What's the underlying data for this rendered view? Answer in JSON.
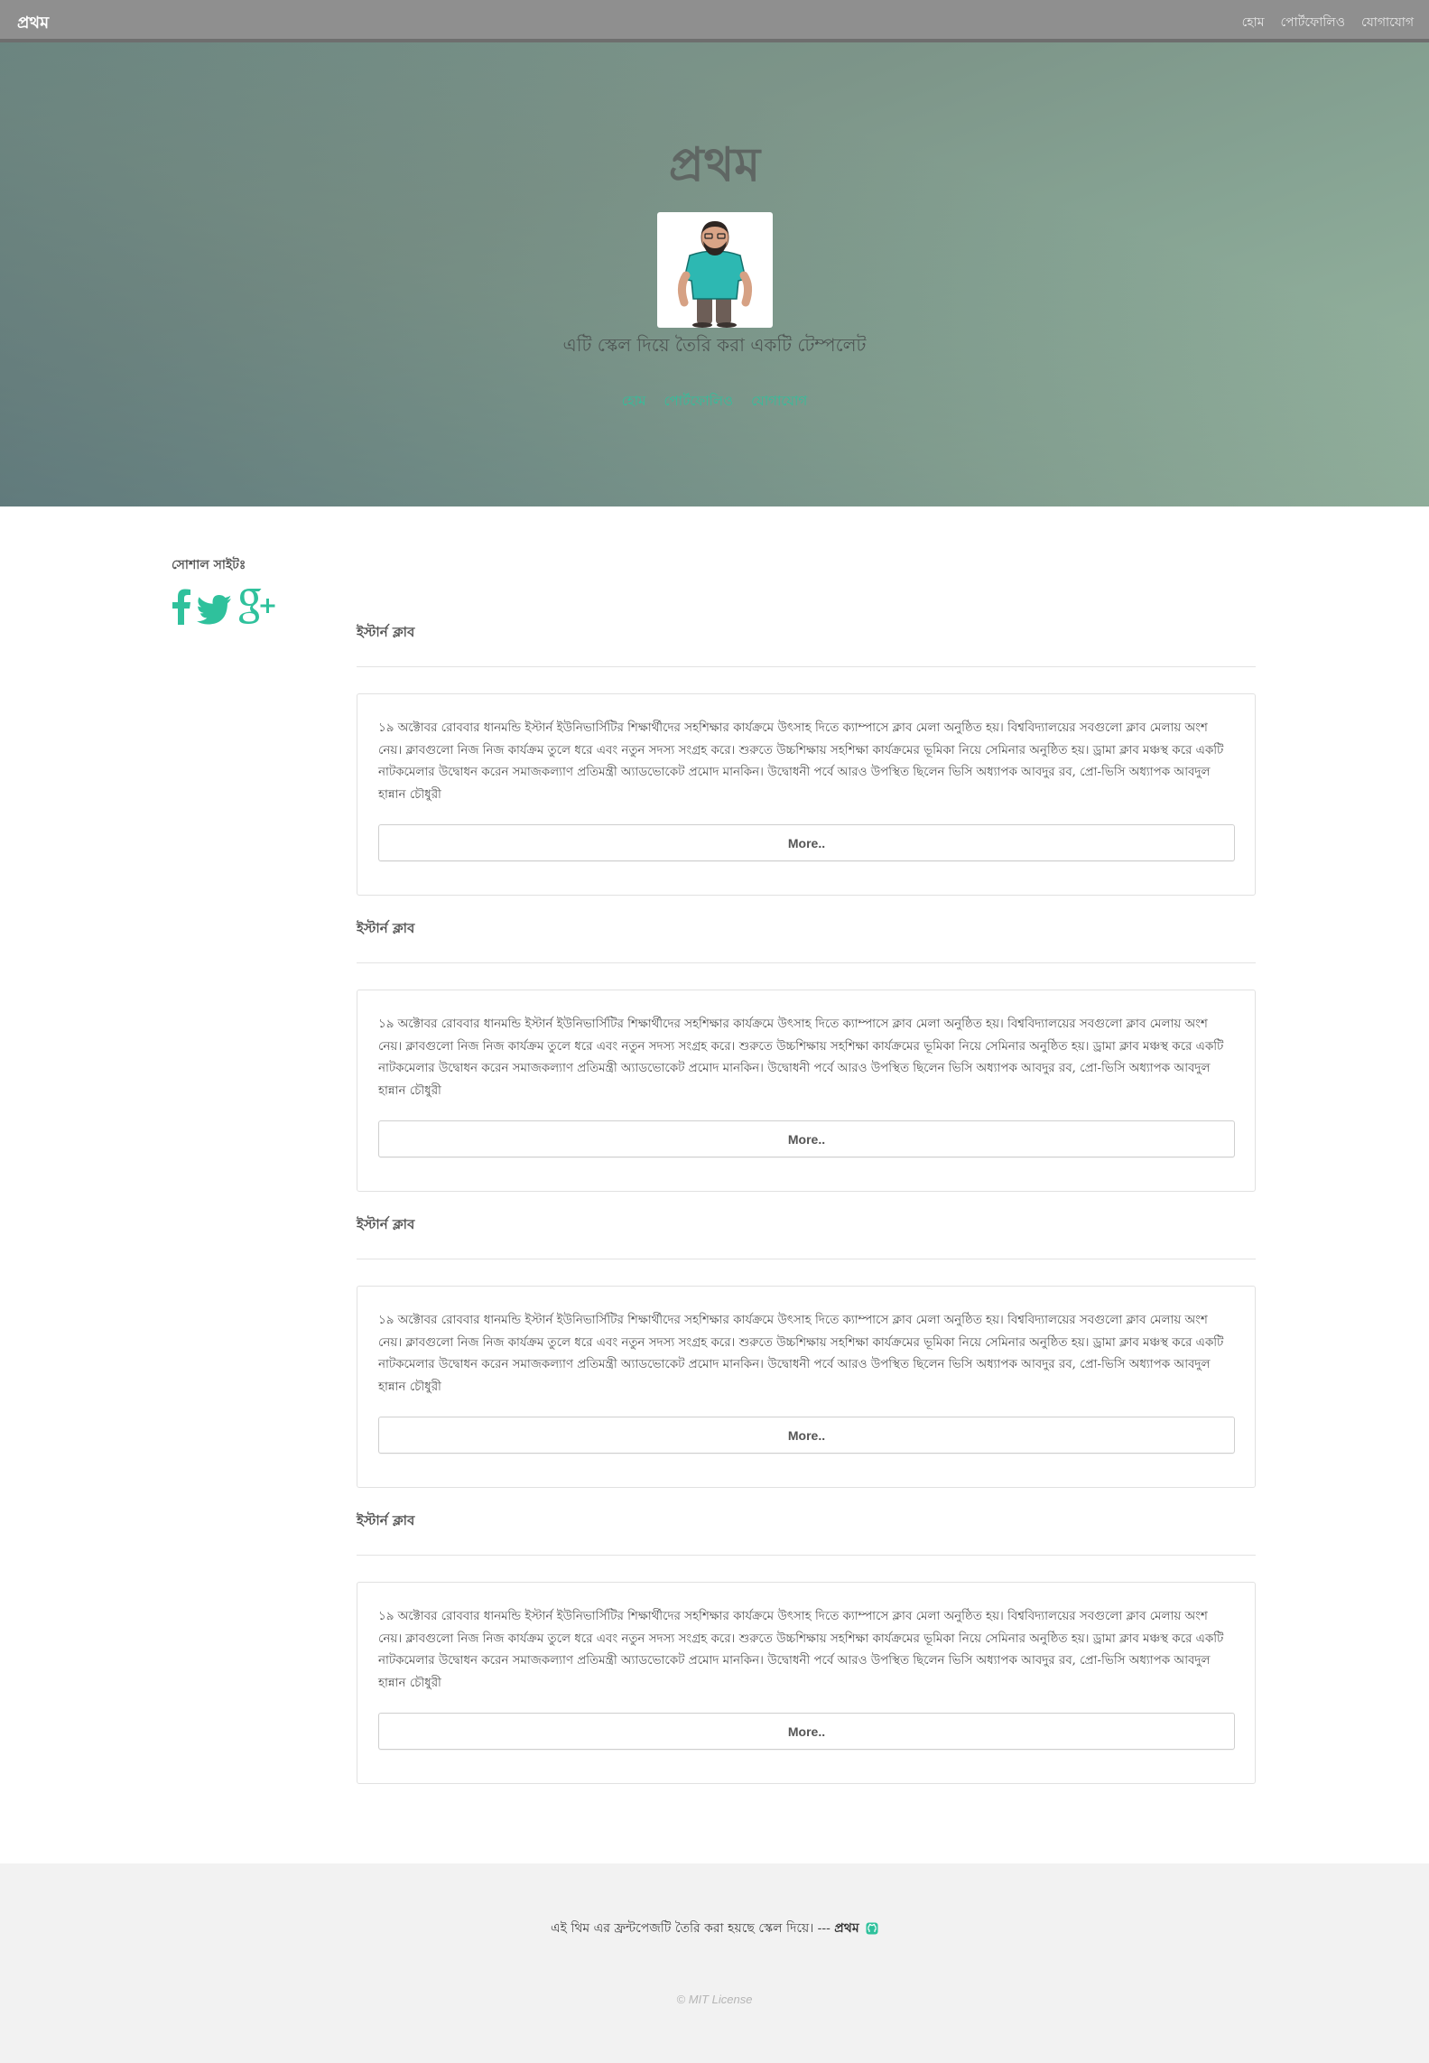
{
  "nav": {
    "brand": "প্রথম",
    "links": [
      "হোম",
      "পোর্টফোলিও",
      "যোগাযোগ"
    ]
  },
  "hero": {
    "title": "প্রথম",
    "subtitle": "এটি স্কেল দিয়ে তৈরি করা একটি টেম্পলেট",
    "links": [
      "হোম",
      "পোর্টফোলিও",
      "যোগাযোগ"
    ]
  },
  "sidebar": {
    "label": "সোশাল সাইটঃ",
    "icons": [
      "facebook-icon",
      "twitter-icon",
      "google-plus-icon"
    ]
  },
  "posts": [
    {
      "title": "ইস্টার্ন ক্লাব",
      "lines": [
        "১৯ অক্টোবর রোববার ধানমন্ডি ইস্টার্ন ইউনিভার্সিটির শিক্ষার্থীদের সহশিক্ষার কার্যক্রমে উৎসাহ দিতে ক্যাম্পাসে ক্লাব মেলা অনুষ্ঠিত হয়। বিশ্ববিদ্যালয়ের সবগুলো ক্লাব মেলায় অংশ",
        "নেয়। ক্লাবগুলো নিজ নিজ কার্যক্রম তুলে ধরে এবং নতুন সদস্য সংগ্রহ করে। শুরুতে উচ্চশিক্ষায় সহশিক্ষা কার্যক্রমের ভূমিকা নিয়ে সেমিনার অনুষ্ঠিত হয়। ড্রামা ক্লাব মঞ্চস্থ করে একটি",
        "নাটকমেলার উদ্বোধন করেন সমাজকল্যাণ প্রতিমন্ত্রী অ্যাডভোকেট প্রমোদ মানকিন। উদ্বোধনী পর্বে আরও উপস্থিত ছিলেন ভিসি অধ্যাপক আবদুর রব, প্রো-ভিসি অধ্যাপক আবদুল",
        "হান্নান চৌধুরী"
      ],
      "button": "More.."
    },
    {
      "title": "ইস্টার্ন ক্লাব",
      "lines": [
        "১৯ অক্টোবর রোববার ধানমন্ডি ইস্টার্ন ইউনিভার্সিটির শিক্ষার্থীদের সহশিক্ষার কার্যক্রমে উৎসাহ দিতে ক্যাম্পাসে ক্লাব মেলা অনুষ্ঠিত হয়। বিশ্ববিদ্যালয়ের সবগুলো ক্লাব মেলায় অংশ",
        "নেয়। ক্লাবগুলো নিজ নিজ কার্যক্রম তুলে ধরে এবং নতুন সদস্য সংগ্রহ করে। শুরুতে উচ্চশিক্ষায় সহশিক্ষা কার্যক্রমের ভূমিকা নিয়ে সেমিনার অনুষ্ঠিত হয়। ড্রামা ক্লাব মঞ্চস্থ করে একটি",
        "নাটকমেলার উদ্বোধন করেন সমাজকল্যাণ প্রতিমন্ত্রী অ্যাডভোকেট প্রমোদ মানকিন। উদ্বোধনী পর্বে আরও উপস্থিত ছিলেন ভিসি অধ্যাপক আবদুর রব, প্রো-ভিসি অধ্যাপক আবদুল",
        "হান্নান চৌধুরী"
      ],
      "button": "More.."
    },
    {
      "title": "ইস্টার্ন ক্লাব",
      "lines": [
        "১৯ অক্টোবর রোববার ধানমন্ডি ইস্টার্ন ইউনিভার্সিটির শিক্ষার্থীদের সহশিক্ষার কার্যক্রমে উৎসাহ দিতে ক্যাম্পাসে ক্লাব মেলা অনুষ্ঠিত হয়। বিশ্ববিদ্যালয়ের সবগুলো ক্লাব মেলায় অংশ",
        "নেয়। ক্লাবগুলো নিজ নিজ কার্যক্রম তুলে ধরে এবং নতুন সদস্য সংগ্রহ করে। শুরুতে উচ্চশিক্ষায় সহশিক্ষা কার্যক্রমের ভূমিকা নিয়ে সেমিনার অনুষ্ঠিত হয়। ড্রামা ক্লাব মঞ্চস্থ করে একটি",
        "নাটকমেলার উদ্বোধন করেন সমাজকল্যাণ প্রতিমন্ত্রী অ্যাডভোকেট প্রমোদ মানকিন। উদ্বোধনী পর্বে আরও উপস্থিত ছিলেন ভিসি অধ্যাপক আবদুর রব, প্রো-ভিসি অধ্যাপক আবদুল",
        "হান্নান চৌধুরী"
      ],
      "button": "More.."
    },
    {
      "title": "ইস্টার্ন ক্লাব",
      "lines": [
        "১৯ অক্টোবর রোববার ধানমন্ডি ইস্টার্ন ইউনিভার্সিটির শিক্ষার্থীদের সহশিক্ষার কার্যক্রমে উৎসাহ দিতে ক্যাম্পাসে ক্লাব মেলা অনুষ্ঠিত হয়। বিশ্ববিদ্যালয়ের সবগুলো ক্লাব মেলায় অংশ",
        "নেয়। ক্লাবগুলো নিজ নিজ কার্যক্রম তুলে ধরে এবং নতুন সদস্য সংগ্রহ করে। শুরুতে উচ্চশিক্ষায় সহশিক্ষা কার্যক্রমের ভূমিকা নিয়ে সেমিনার অনুষ্ঠিত হয়। ড্রামা ক্লাব মঞ্চস্থ করে একটি",
        "নাটকমেলার উদ্বোধন করেন সমাজকল্যাণ প্রতিমন্ত্রী অ্যাডভোকেট প্রমোদ মানকিন। উদ্বোধনী পর্বে আরও উপস্থিত ছিলেন ভিসি অধ্যাপক আবদুর রব, প্রো-ভিসি অধ্যাপক আবদুল",
        "হান্নান চৌধুরী"
      ],
      "button": "More.."
    }
  ],
  "footer": {
    "credit_text": "এই থিম এর ফ্রন্টপেজটি তৈরি করা হয়ছে স্কেল দিয়ে। ---",
    "credit_brand": "প্রথম",
    "license": "© MIT License"
  },
  "colors": {
    "accent": "#2fc19c",
    "nav_bg": "#8f8f8f",
    "footer_bg": "#f2f2f2"
  }
}
